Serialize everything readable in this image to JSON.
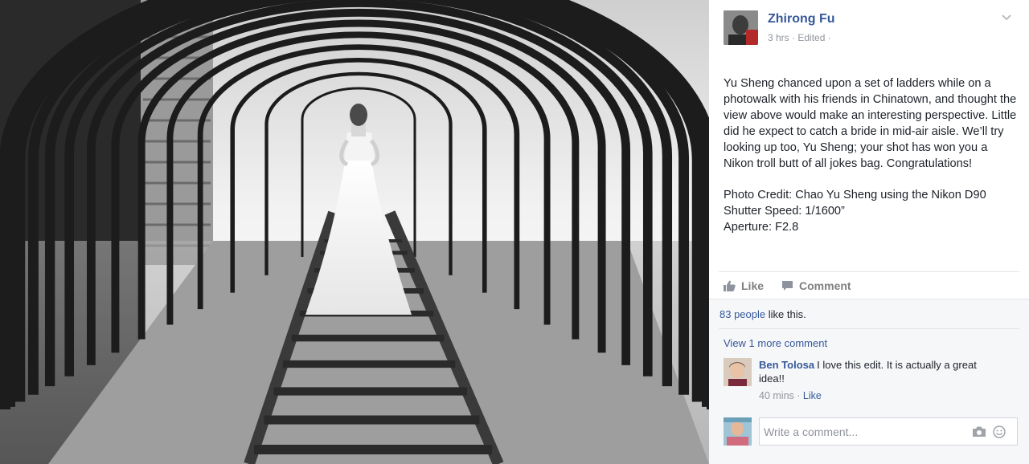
{
  "post": {
    "author": "Zhirong Fu",
    "time": "3 hrs",
    "edited": "Edited",
    "paragraph1": "Yu Sheng chanced upon a set of ladders while on a photowalk with his friends in Chinatown, and thought the view above would make an interesting perspective. Little did he expect to catch a bride in mid-air aisle. We’ll try looking up too, Yu Sheng; your shot has won you a Nikon troll butt of all jokes bag. Congratulations!",
    "credit_lines": [
      "Photo Credit: Chao Yu Sheng using the Nikon D90",
      "Shutter Speed: 1/1600”",
      "Aperture: F2.8"
    ]
  },
  "actions": {
    "like": "Like",
    "comment": "Comment"
  },
  "feedback": {
    "likes_count": "83 people",
    "likes_suffix": "like this.",
    "view_more": "View 1 more comment",
    "comment": {
      "author": "Ben Tolosa",
      "text": "I love this edit. It is actually a great idea!!",
      "time": "40 mins",
      "like": "Like"
    },
    "write_placeholder": "Write a comment..."
  },
  "icons": {
    "options": "chevron-down-icon",
    "like": "thumbs-up-icon",
    "comment": "speech-bubble-icon",
    "camera": "camera-icon",
    "emoji": "smiley-icon"
  },
  "colors": {
    "link": "#365899",
    "text": "#1d2129",
    "meta": "#90949c",
    "feedback_bg": "#f6f7f9"
  }
}
